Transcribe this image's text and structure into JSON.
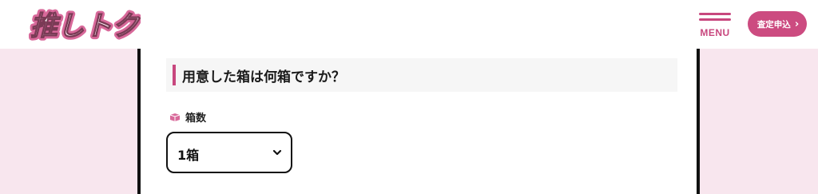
{
  "header": {
    "logo_text": "推しトク",
    "menu_label": "MENU",
    "cta_label": "査定申込",
    "cta_chevron": "›"
  },
  "question": {
    "heading": "用意した箱は何箱ですか？"
  },
  "field": {
    "label": "箱数",
    "selected_value": "1箱"
  },
  "colors": {
    "brand_pink": "#c8477e",
    "background_pink": "#f8e6ee"
  }
}
